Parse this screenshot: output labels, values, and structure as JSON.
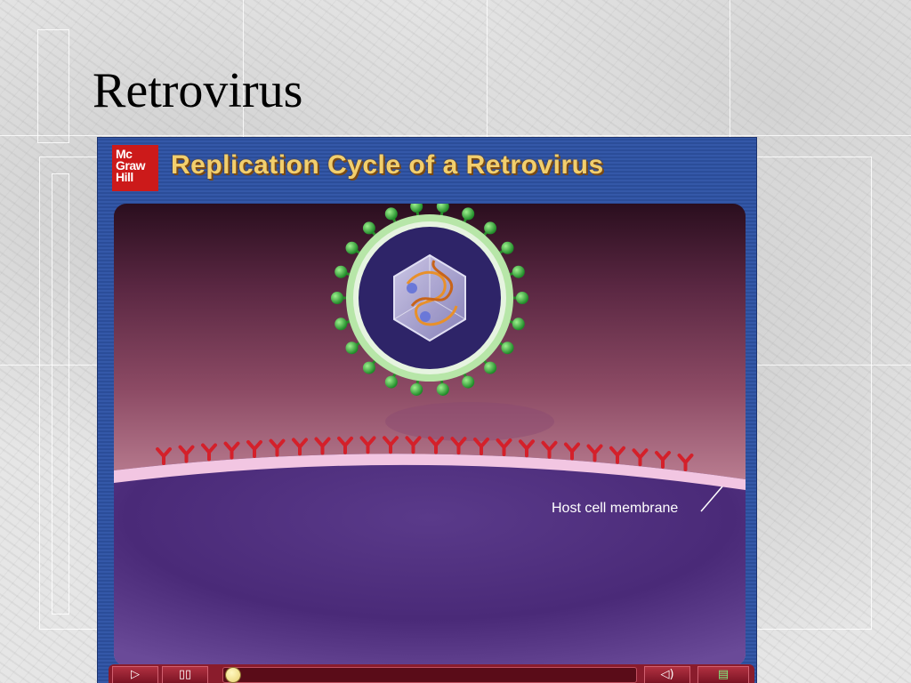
{
  "slide": {
    "title": "Retrovirus"
  },
  "player": {
    "logo_lines": [
      "Mc",
      "Graw",
      "Hill"
    ],
    "header_title": "Replication Cycle of a Retrovirus",
    "animation": {
      "label_membrane": "Host cell membrane"
    },
    "controls": {
      "play_icon": "play-icon",
      "pause_icon": "pause-icon",
      "volume_icon": "speaker-icon",
      "notes_icon": "notes-icon",
      "play_glyph": "▷",
      "pause_glyph": "▯▯",
      "volume_glyph": "◁)",
      "notes_glyph": "▤",
      "progress": 0.0
    }
  },
  "colors": {
    "player_blue": "#3458a8",
    "title_gold": "#f2cf6d",
    "logo_red": "#cc1a1a",
    "receptor_red": "#d4202a",
    "spike_green": "#3fb83f",
    "control_bar": "#8a1c2c"
  }
}
